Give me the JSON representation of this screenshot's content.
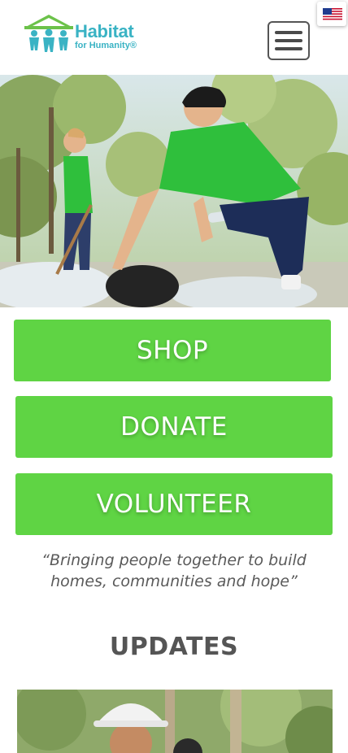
{
  "header": {
    "logo_line1": "Habitat",
    "logo_line2": "for Humanity®",
    "menu_icon": "hamburger-menu-icon",
    "language_flag": "us-flag-icon"
  },
  "hero": {
    "image": "volunteers-collecting-trash-photo"
  },
  "actions": {
    "shop_label": "SHOP",
    "donate_label": "DONATE",
    "volunteer_label": "VOLUNTEER"
  },
  "tagline": "“Bringing people together to build homes, communities and hope”",
  "updates": {
    "title": "UPDATES",
    "image": "volunteer-hard-hat-photo"
  },
  "colors": {
    "brand_green": "#5fd444",
    "logo_green": "#6cc24a",
    "logo_teal": "#3ab3c4",
    "text_gray": "#555555"
  }
}
